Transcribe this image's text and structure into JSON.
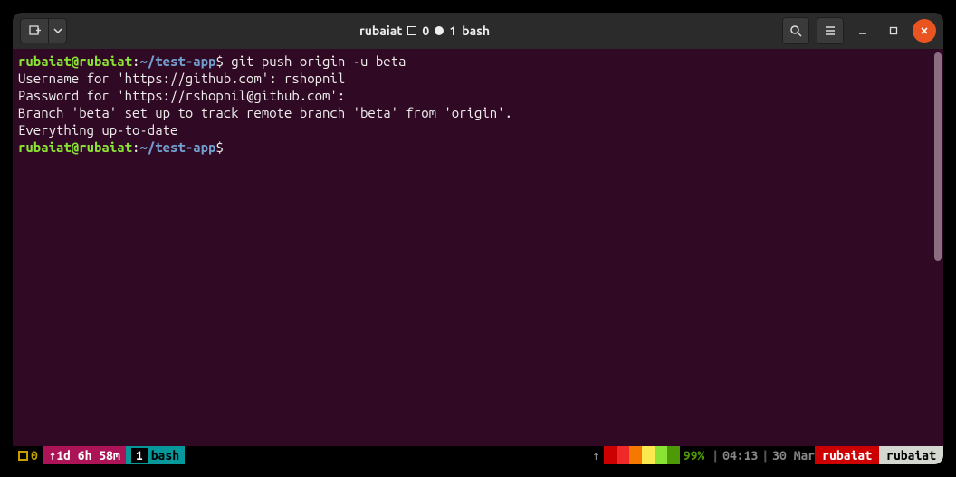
{
  "title": {
    "user": "rubaiat",
    "count_open": "0",
    "count_filled": "1",
    "shell": "bash"
  },
  "terminal": {
    "prompt": {
      "userhost": "rubaiat@rubaiat",
      "colon": ":",
      "path": "~/test-app",
      "dollar": "$"
    },
    "lines": [
      {
        "type": "cmd",
        "text": "git push origin -u beta"
      },
      {
        "type": "out",
        "text": "Username for 'https://github.com': rshopnil"
      },
      {
        "type": "out",
        "text": "Password for 'https://rshopnil@github.com':"
      },
      {
        "type": "out",
        "text": "Branch 'beta' set up to track remote branch 'beta' from 'origin'."
      },
      {
        "type": "out",
        "text": "Everything up-to-date"
      }
    ]
  },
  "status": {
    "session_index": "0",
    "uptime": "1d 6h 58m",
    "window_index": "1",
    "window_name": "bash",
    "battery_pct": "99%",
    "time": "04:13",
    "date": "30 Mar",
    "host": "rubaiat",
    "user": "rubaiat"
  }
}
